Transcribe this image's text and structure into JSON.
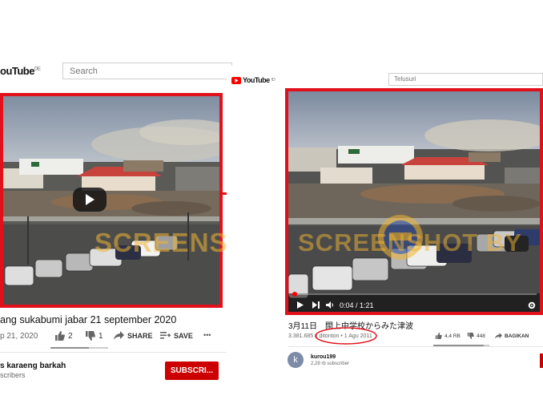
{
  "left": {
    "logo_text": "ouTube",
    "logo_region": "DE",
    "search_placeholder": "Search",
    "watermark": "SCREENSHOT BY",
    "title": "ang sukabumi jabar 21 september 2020",
    "date": "p 21, 2020",
    "like_count": "2",
    "dislike_count": "1",
    "share_label": "SHARE",
    "save_label": "SAVE",
    "more_label": "•••",
    "channel_name": "s karaeng barkah",
    "subscribers": "scribers",
    "subscribe_label": "SUBSCRI..."
  },
  "right": {
    "logo_text": "YouTube",
    "logo_region": "ID",
    "search_placeholder": "Telusuri",
    "watermark": "SCREENSHOT BY",
    "time_display": "0:04 / 1:21",
    "title": "3月11日　閖上中学校からみた津波",
    "views_text": "3.381.685 x ditonton",
    "upload_date": "• 1 Agu 2011",
    "like_count": "4,4 RB",
    "dislike_count": "448",
    "share_label": "BAGIKAN",
    "channel_avatar_letter": "k",
    "channel_name": "kurou199",
    "subscribers": "2,29 rb subscriber"
  },
  "colors": {
    "highlight_red": "#e1111b",
    "youtube_red": "#ff0000",
    "subscribe_red": "#cc0000"
  }
}
